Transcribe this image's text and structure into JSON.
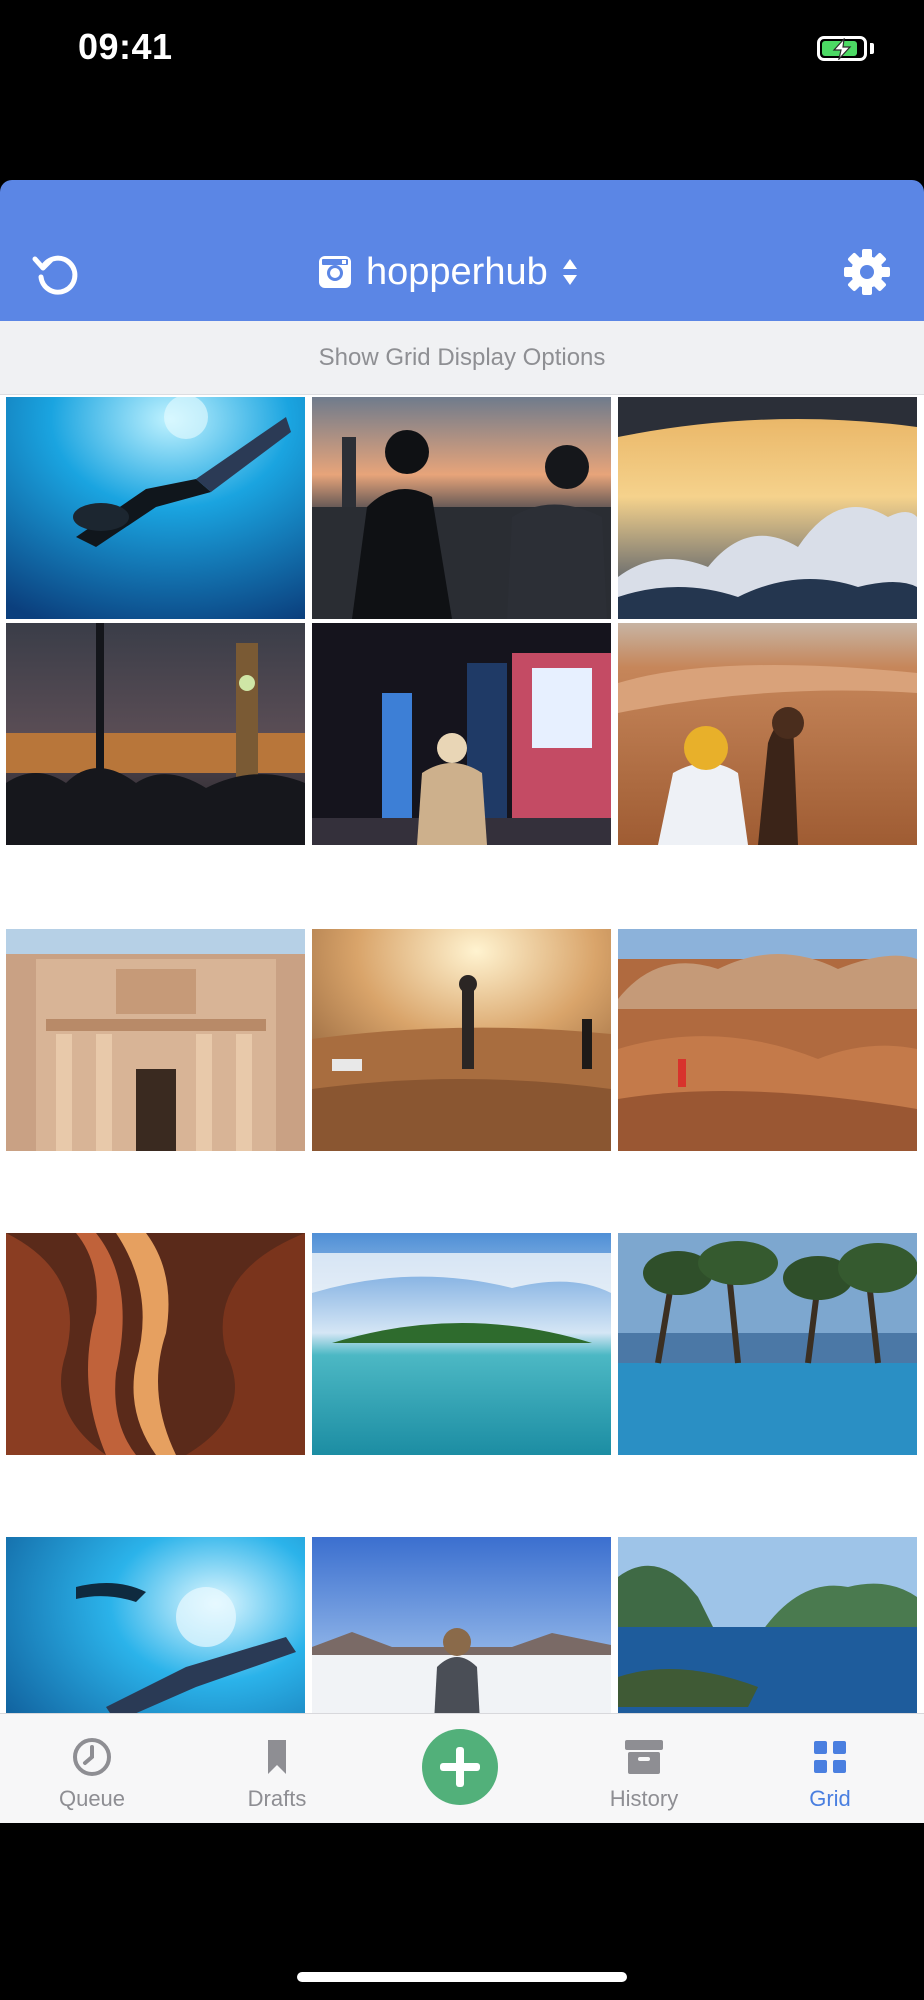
{
  "status_bar": {
    "time": "09:41",
    "battery_level": 0.8,
    "battery_color": "#4cd964"
  },
  "header": {
    "account_name": "hopperhub",
    "accent_color": "#5b86e5",
    "icons": [
      "refresh-icon",
      "instagram-icon",
      "sort-arrows-icon",
      "gear-icon"
    ]
  },
  "grid_options": {
    "label": "Show Grid Display Options"
  },
  "grid": {
    "photos": [
      {
        "subject": "scuba-diver-underwater"
      },
      {
        "subject": "couple-city-skyline-sunset"
      },
      {
        "subject": "clouds-from-airplane"
      },
      {
        "subject": "big-ben-night"
      },
      {
        "subject": "times-square-night"
      },
      {
        "subject": "desert-camel"
      },
      {
        "subject": "petra-treasury"
      },
      {
        "subject": "desert-dunes-people"
      },
      {
        "subject": "red-rock-hiker"
      },
      {
        "subject": "slot-canyon"
      },
      {
        "subject": "tropical-island-lagoon"
      },
      {
        "subject": "infinity-pool-trees"
      },
      {
        "subject": "diver-underwater-2"
      },
      {
        "subject": "salt-flat-woman"
      },
      {
        "subject": "bay-islands-cliffs"
      }
    ]
  },
  "tabs": [
    {
      "label": "Queue",
      "icon": "clock-icon",
      "active": false
    },
    {
      "label": "Drafts",
      "icon": "bookmark-icon",
      "active": false
    },
    {
      "label": "History",
      "icon": "archive-icon",
      "active": false
    },
    {
      "label": "Grid",
      "icon": "grid-icon",
      "active": true
    }
  ],
  "add_button": {
    "icon": "plus-icon",
    "color": "#52b07a"
  }
}
